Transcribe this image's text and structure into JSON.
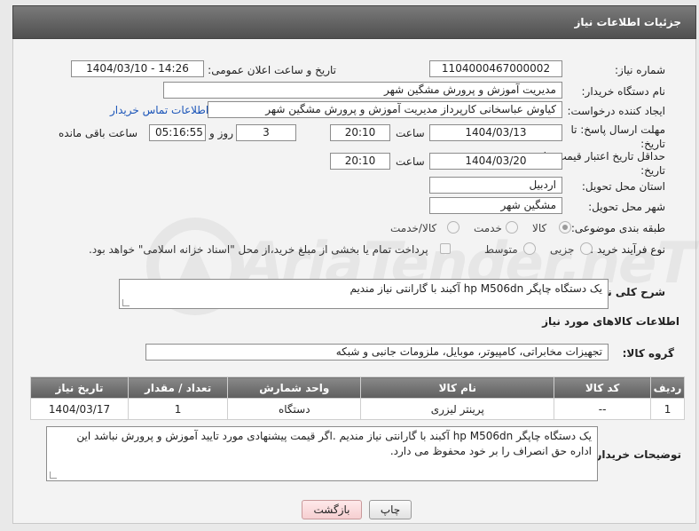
{
  "header": {
    "title": "جزئیات اطلاعات نیاز"
  },
  "fields": {
    "need_number_label": "شماره نیاز:",
    "need_number": "1104000467000002",
    "announce_label": "تاریخ و ساعت اعلان عمومی:",
    "announce_value": "1404/03/10 - 14:26",
    "buyer_org_label": "نام دستگاه خریدار:",
    "buyer_org": "مدیریت آموزش و پرورش مشگین شهر",
    "requester_label": "ایجاد کننده درخواست:",
    "requester": "کیاوش عباسخانی کارپرداز مدیریت آموزش و پرورش مشگین شهر",
    "contact_link": "اطلاعات تماس خریدار",
    "deadline_label": "مهلت ارسال پاسخ: تا تاریخ:",
    "deadline_date": "1404/03/13",
    "time_label": "ساعت",
    "deadline_time": "20:10",
    "days_value": "3",
    "days_label": "روز و",
    "remaining_time": "05:16:55",
    "remaining_label": "ساعت باقی مانده",
    "validity_label": "حداقل تاریخ اعتبار قیمت: تا تاریخ:",
    "validity_date": "1404/03/20",
    "validity_time": "20:10",
    "province_label": "استان محل تحویل:",
    "province": "اردبیل",
    "city_label": "شهر محل تحویل:",
    "city": "مشگین شهر",
    "category_label": "طبقه بندی موضوعی:",
    "category_options": [
      "کالا",
      "خدمت",
      "کالا/خدمت"
    ],
    "category_selected": "کالا",
    "process_label": "نوع فرآیند خرید :",
    "process_options": [
      "جزیی",
      "متوسط"
    ],
    "payment_note": "پرداخت تمام یا بخشی از مبلغ خرید،از محل \"اسناد خزانه اسلامی\" خواهد بود."
  },
  "description": {
    "label": "شرح کلی نیاز:",
    "value": "یک دستگاه چاپگر hp M506dn آکبند با گارانتی نیاز مندیم"
  },
  "goods": {
    "section_title": "اطلاعات کالاهای مورد نیاز",
    "group_label": "گروه کالا:",
    "group_value": "تجهیزات مخابراتی، کامپیوتر، موبایل، ملزومات جانبی و شبکه",
    "columns": [
      "ردیف",
      "کد کالا",
      "نام کالا",
      "واحد شمارش",
      "تعداد / مقدار",
      "تاریخ نیاز"
    ],
    "rows": [
      [
        "1",
        "--",
        "پرینتر لیزری",
        "دستگاه",
        "1",
        "1404/03/17"
      ]
    ]
  },
  "buyer_notes": {
    "label": "توضیحات خریدار:",
    "value": "یک دستگاه چاپگر hp M506dn آکبند با گارانتی نیاز مندیم .اگر قیمت پیشنهادی مورد تایید آموزش و پرورش نباشد این اداره حق انصراف را بر خود محفوظ می دارد."
  },
  "buttons": {
    "print": "چاپ",
    "back": "بازگشت"
  },
  "watermark": "AriaTender.neT",
  "colors": {
    "link": "#1a54b8",
    "header": "#5e5e5e",
    "back_button": "#f6cfd1"
  }
}
